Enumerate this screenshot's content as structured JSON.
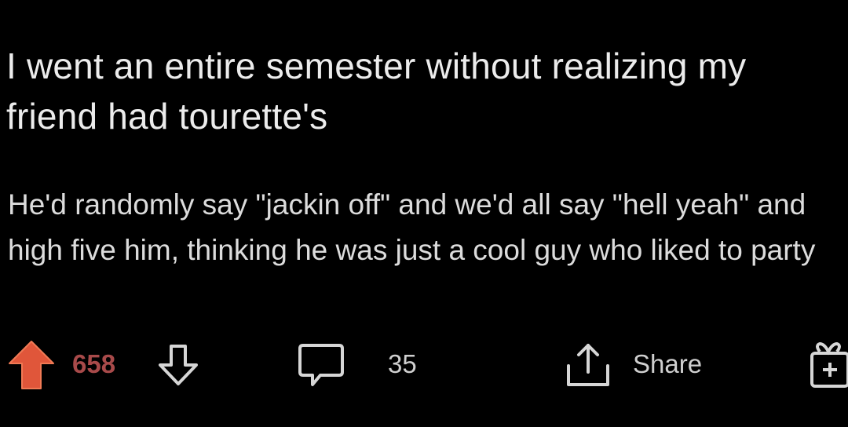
{
  "post": {
    "title": "I went an entire semester without realizing my friend had tourette's",
    "body": "He'd randomly say \"jackin off\" and we'd all say \"hell yeah\" and high five him, thinking he was just a cool guy who liked to party"
  },
  "actions": {
    "score": "658",
    "comment_count": "35",
    "share_label": "Share",
    "upvote_icon": "arrow-up-filled-icon",
    "downvote_icon": "arrow-down-outline-icon",
    "comment_icon": "speech-bubble-icon",
    "share_icon": "share-arrow-icon",
    "award_icon": "gift-box-icon"
  },
  "colors": {
    "background": "#000000",
    "text": "#e4e4e4",
    "upvote_active": "#e0563a",
    "score_active": "#a84a4a",
    "icon": "#d6d6d6"
  }
}
